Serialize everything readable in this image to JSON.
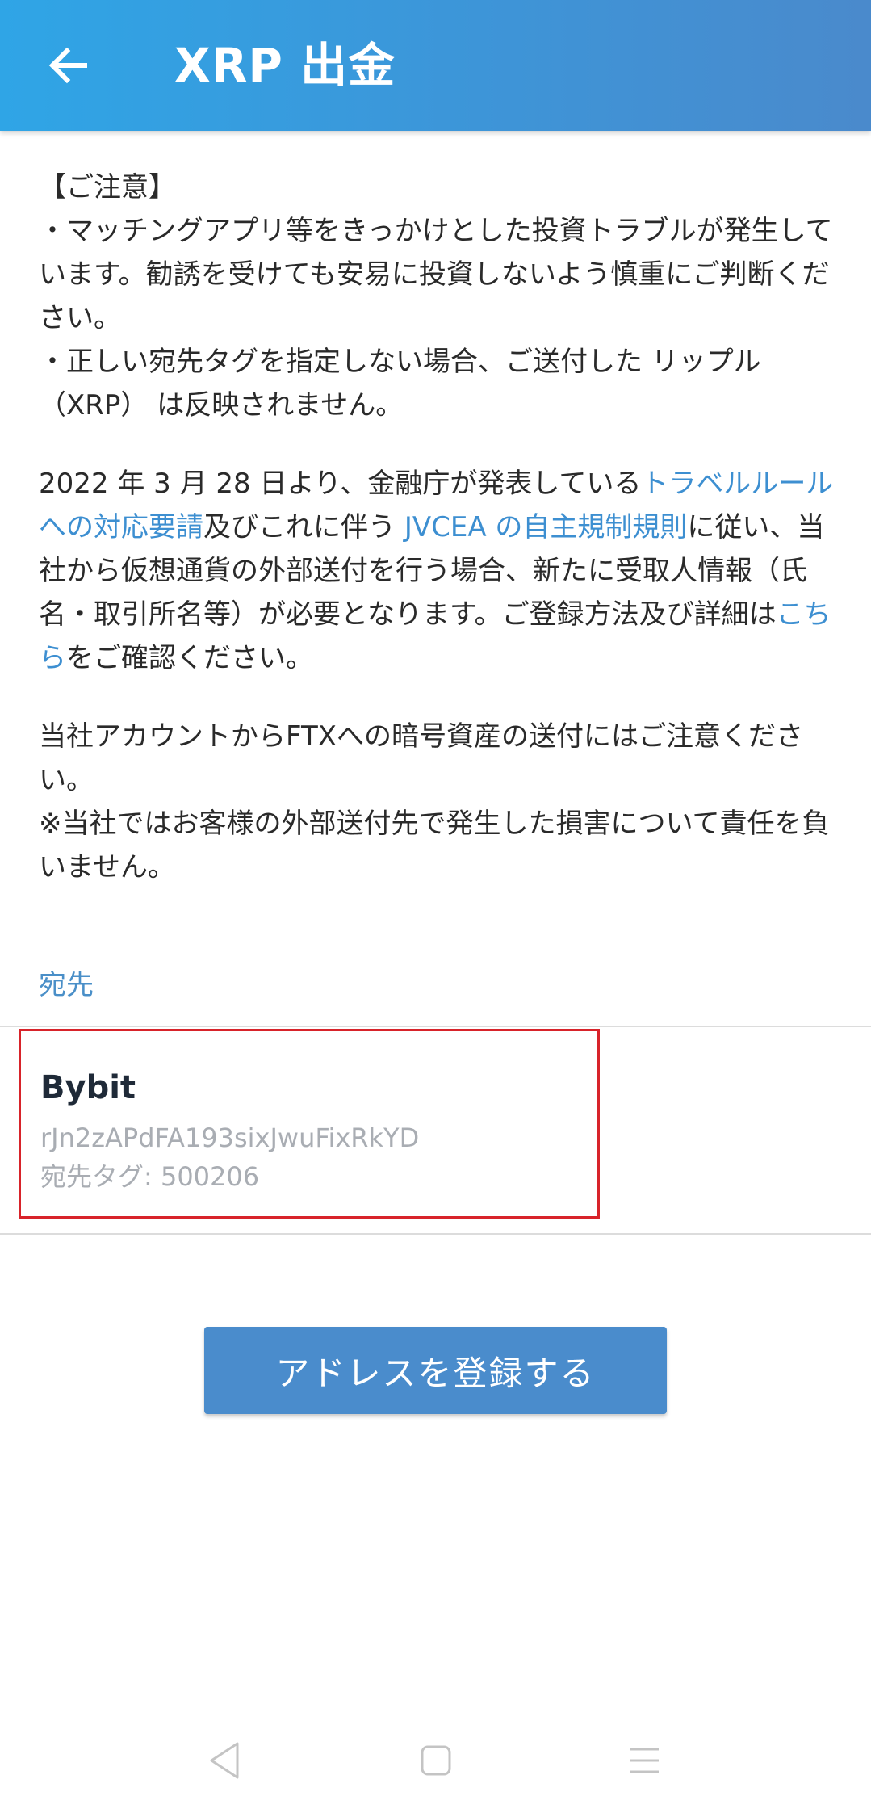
{
  "appbar": {
    "title": "XRP 出金",
    "back_icon": "arrow-left-icon"
  },
  "notice": {
    "heading": "【ご注意】",
    "bullet1": "・マッチングアプリ等をきっかけとした投資トラブルが発生しています。勧誘を受けても安易に投資しないよう慎重にご判断ください。",
    "bullet2": "・正しい宛先タグを指定しない場合、ご送付した リップル（XRP） は反映されません。",
    "travel_rule": {
      "part1": "2022 年 3 月 28 日より、金融庁が発表している",
      "link1": "トラベルルールへの対応要請",
      "part2": "及びこれに伴う ",
      "link2": "JVCEA の自主規制規則",
      "part3": "に従い、当社から仮想通貨の外部送付を行う場合、新たに受取人情報（氏名・取引所名等）が必要となります。ご登録方法及び詳細は",
      "link3": "こちら",
      "part4": "をご確認ください。"
    },
    "ftx_warning": "当社アカウントからFTXへの暗号資産の送付にはご注意ください。",
    "disclaimer": "※当社ではお客様の外部送付先で発生した損害について責任を負いません。"
  },
  "destination": {
    "label": "宛先",
    "name": "Bybit",
    "address": "rJn2zAPdFA193sixJwuFixRkYD",
    "tag": "宛先タグ: 500206",
    "highlight_color": "#d8232a"
  },
  "register_button": {
    "label": "アドレスを登録する",
    "color": "#4a8ccc"
  },
  "navbar": {
    "back_icon": "triangle-back-icon",
    "home_icon": "square-home-icon",
    "menu_icon": "hamburger-menu-icon"
  },
  "colors": {
    "appbar_start": "#2fa5e6",
    "appbar_end": "#4a8acc",
    "link": "#3d8fd1"
  }
}
